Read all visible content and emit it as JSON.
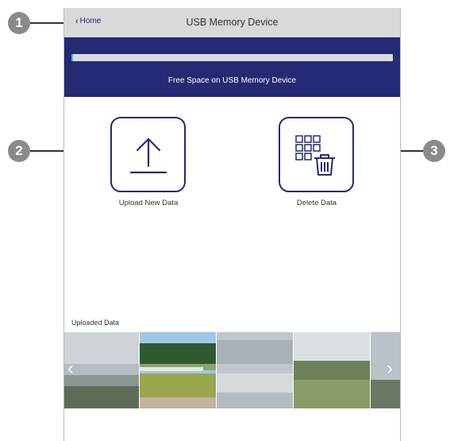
{
  "header": {
    "home_label": "Home",
    "title": "USB Memory Device"
  },
  "storage": {
    "label": "Free Space on USB Memory Device",
    "used_fraction": 0.005
  },
  "actions": {
    "upload_label": "Upload New Data",
    "delete_label": "Delete Data"
  },
  "uploaded": {
    "title": "Uploaded Data"
  },
  "callouts": [
    "1",
    "2",
    "3"
  ],
  "icons": {
    "home": "chevron-left-icon",
    "upload": "upload-arrow-icon",
    "delete": "grid-trash-icon",
    "prev": "chevron-left-icon",
    "next": "chevron-right-icon"
  },
  "colors": {
    "brand": "#242a73",
    "header_bg": "#d9d9d9",
    "callout": "#8a8a8a"
  }
}
